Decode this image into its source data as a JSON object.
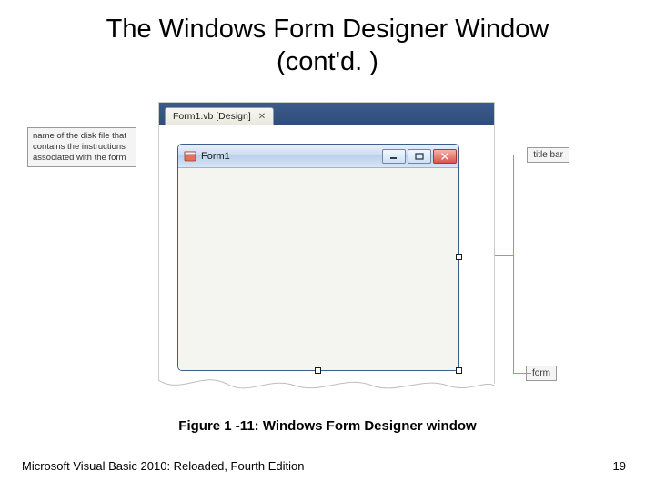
{
  "title_line1": "The Windows Form Designer Window",
  "title_line2": "(cont'd. )",
  "callouts": {
    "file_desc": "name of the disk file that contains the instructions associated with the form",
    "title_bar": "title bar",
    "form": "form"
  },
  "designer": {
    "tab_label": "Form1.vb [Design]",
    "tab_close": "✕",
    "form_title": "Form1"
  },
  "caption": "Figure 1 -11: Windows Form Designer window",
  "footer": {
    "book": "Microsoft Visual Basic 2010: Reloaded, Fourth Edition",
    "page": "19"
  }
}
